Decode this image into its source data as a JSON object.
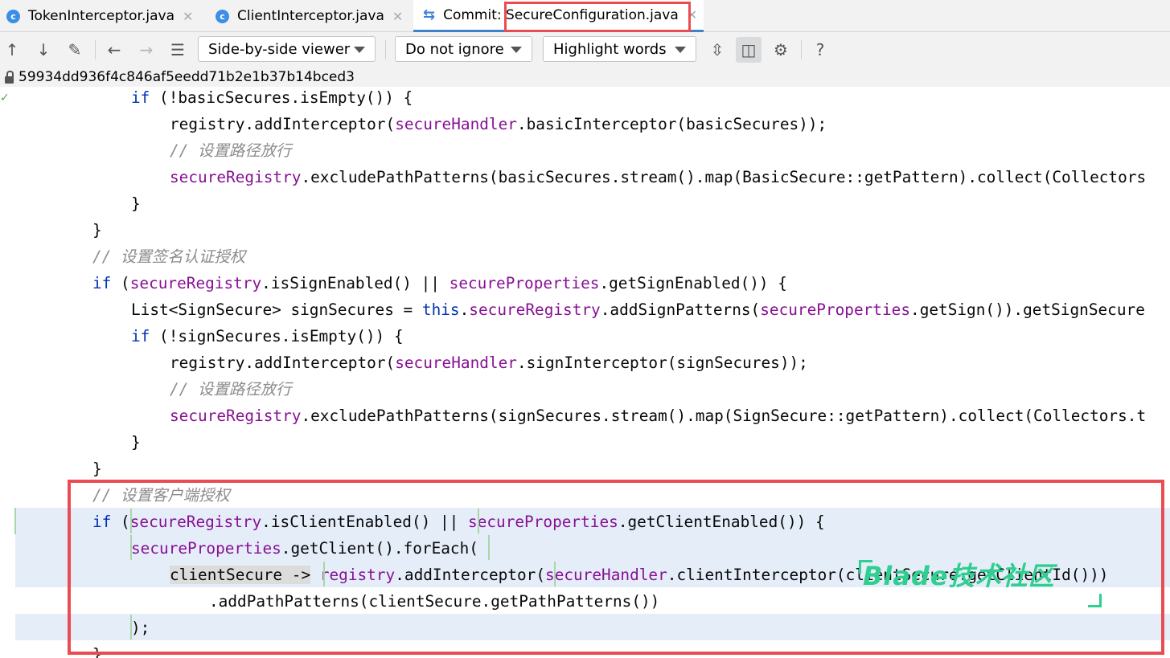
{
  "tabs": [
    {
      "label": "TokenInterceptor.java",
      "icon": "c"
    },
    {
      "label": "ClientInterceptor.java",
      "icon": "c"
    },
    {
      "label": "Commit: ",
      "icon": "commit-icon"
    },
    {
      "label": "SecureConfiguration.java"
    }
  ],
  "toolbar": {
    "viewer": "Side-by-side viewer",
    "whitespace": "Do not ignore",
    "highlight": "Highlight words",
    "help": "?"
  },
  "commit_hash": "59934dd936f4c846af5eedd71b2e1b37b14bced3",
  "code": {
    "l1": [
      "if",
      " (!basicSecures.isEmpty()) {"
    ],
    "l2": [
      "registry.addInterceptor(",
      "secureHandler",
      ".basicInterceptor(basicSecures));"
    ],
    "l3": "// 设置路径放行",
    "l4": [
      "secureRegistry",
      ".excludePathPatterns(basicSecures.stream().map(BasicSecure::getPattern).collect(Collectors"
    ],
    "l5": "}",
    "l6": "}",
    "l7": "// 设置签名认证授权",
    "l8": [
      "if",
      " (",
      "secureRegistry",
      ".isSignEnabled() || ",
      "secureProperties",
      ".getSignEnabled()) {"
    ],
    "l9": [
      "List<SignSecure> signSecures = ",
      "this",
      ".",
      "secureRegistry",
      ".addSignPatterns(",
      "secureProperties",
      ".getSign()).getSignSecure"
    ],
    "l10": [
      "if",
      " (!signSecures.isEmpty()) {"
    ],
    "l11": [
      "registry.addInterceptor(",
      "secureHandler",
      ".signInterceptor(signSecures));"
    ],
    "l12": "// 设置路径放行",
    "l13": [
      "secureRegistry",
      ".excludePathPatterns(signSecures.stream().map(SignSecure::getPattern).collect(Collectors.t"
    ],
    "l14": "}",
    "l15": "}",
    "l16": "// 设置客户端授权",
    "l17": [
      "if",
      " (",
      "secureRegistry",
      ".isClientEnabled() || ",
      "secureProperties",
      ".getClientEnabled()) {"
    ],
    "l18": [
      "secureProperties",
      ".getClient().forEach("
    ],
    "l19": [
      "clientSecure ->",
      " ",
      "registry",
      ".addInterceptor(",
      "secureHandler",
      ".clientInterceptor(clientSecure.getClientId()))"
    ],
    "l20": ".addPathPatterns(clientSecure.getPathPatterns())",
    "l21": ");",
    "l22": "}"
  },
  "watermark": "Blade技术社区",
  "colors": {
    "keyword": "#0033b3",
    "field": "#871094",
    "comment": "#8c8c8c",
    "changed_bg": "#e5edf9",
    "annotation_red": "#ea4c51",
    "watermark_green": "#2fcf8f"
  }
}
